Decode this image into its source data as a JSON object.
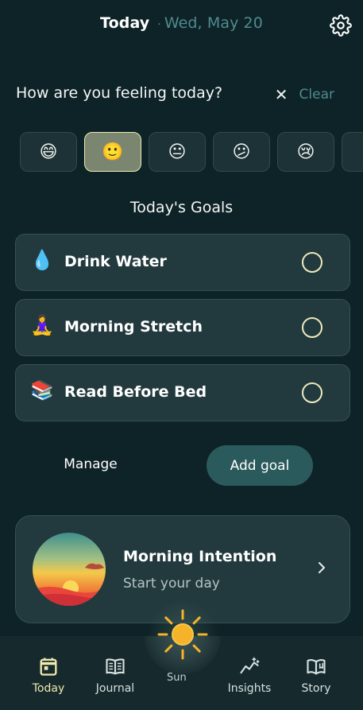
{
  "header": {
    "title": "Today",
    "separator": "·",
    "date": "Wed, May 20",
    "settings_icon": "gear-icon"
  },
  "feeling": {
    "question": "How are you feeling today?",
    "clear_label": "Clear",
    "moods": [
      {
        "emoji": "😄",
        "name": "very-happy"
      },
      {
        "emoji": "🙂",
        "name": "happy",
        "selected": true
      },
      {
        "emoji": "😐",
        "name": "neutral"
      },
      {
        "emoji": "😕",
        "name": "unsure"
      },
      {
        "emoji": "😢",
        "name": "sad"
      }
    ]
  },
  "goals": {
    "title": "Today's Goals",
    "items": [
      {
        "emoji": "💧",
        "label": "Drink Water",
        "done": false
      },
      {
        "emoji": "🧘‍♀️",
        "label": "Morning Stretch",
        "done": false
      },
      {
        "emoji": "📚",
        "label": "Read Before Bed",
        "done": false
      }
    ],
    "manage_label": "Manage",
    "add_label": "Add goal"
  },
  "intention": {
    "title": "Morning Intention",
    "subtitle": "Start your day"
  },
  "nav": {
    "items": [
      {
        "label": "Today",
        "icon": "calendar-icon",
        "active": true
      },
      {
        "label": "Journal",
        "icon": "book-icon",
        "active": false
      },
      {
        "label": "Insights",
        "icon": "insights-icon",
        "active": false
      },
      {
        "label": "Story",
        "icon": "open-book-icon",
        "active": false
      }
    ],
    "center_icon": "sun-icon",
    "center_label": "Sun"
  },
  "colors": {
    "background": "#0e2327",
    "accent_teal": "#4f8b8f",
    "selected_mood": "#7b8670",
    "add_button": "#2b5a5d",
    "sun": "#f5b32a"
  }
}
